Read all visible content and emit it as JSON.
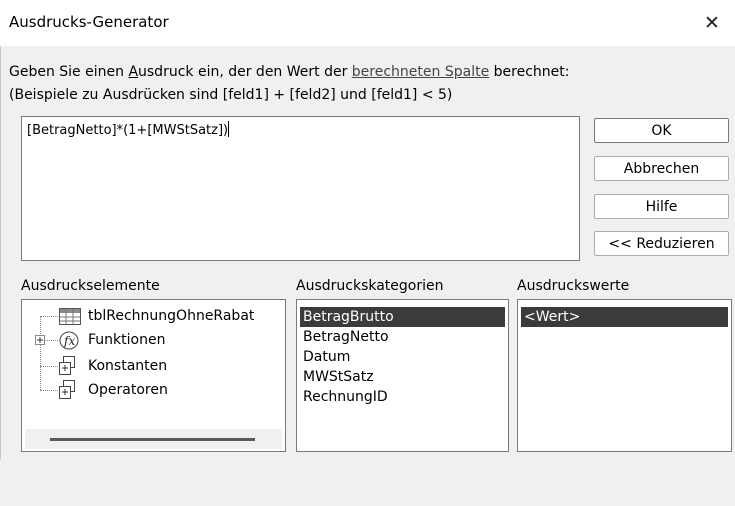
{
  "window": {
    "title": "Ausdrucks-Generator",
    "close_symbol": "✕"
  },
  "instructions": {
    "line1_before": "Geben Sie einen ",
    "line1_accel": "A",
    "line1_mid1": "usdruck ein, der den Wert der ",
    "line1_link": "berechneten Spalte",
    "line1_after": " berechnet:",
    "line2": "(Beispiele zu Ausdrücken sind [feld1] + [feld2] und [feld1] < 5)"
  },
  "expression": {
    "value": "[BetragNetto]*(1+[MWStSatz])"
  },
  "buttons": {
    "ok": "OK",
    "cancel": "Abbrechen",
    "help": "Hilfe",
    "reduce": "<< Reduzieren"
  },
  "elements_pane": {
    "label": "Ausdruckselemente",
    "items": [
      {
        "label": "tblRechnungOhneRabat",
        "icon": "table-icon"
      },
      {
        "label": "Funktionen",
        "icon": "function-icon"
      },
      {
        "label": "Konstanten",
        "icon": "constants-icon"
      },
      {
        "label": "Operatoren",
        "icon": "operators-icon"
      }
    ]
  },
  "categories_pane": {
    "label": "Ausdruckskategorien",
    "items": [
      "BetragBrutto",
      "BetragNetto",
      "Datum",
      "MWStSatz",
      "RechnungID"
    ],
    "selected": "BetragBrutto"
  },
  "values_pane": {
    "label": "Ausdruckswerte",
    "items": [
      "<Wert>"
    ],
    "selected": "<Wert>"
  },
  "colors": {
    "selection_bg": "#3b3b3b",
    "window_bg": "#f0f0f0"
  }
}
